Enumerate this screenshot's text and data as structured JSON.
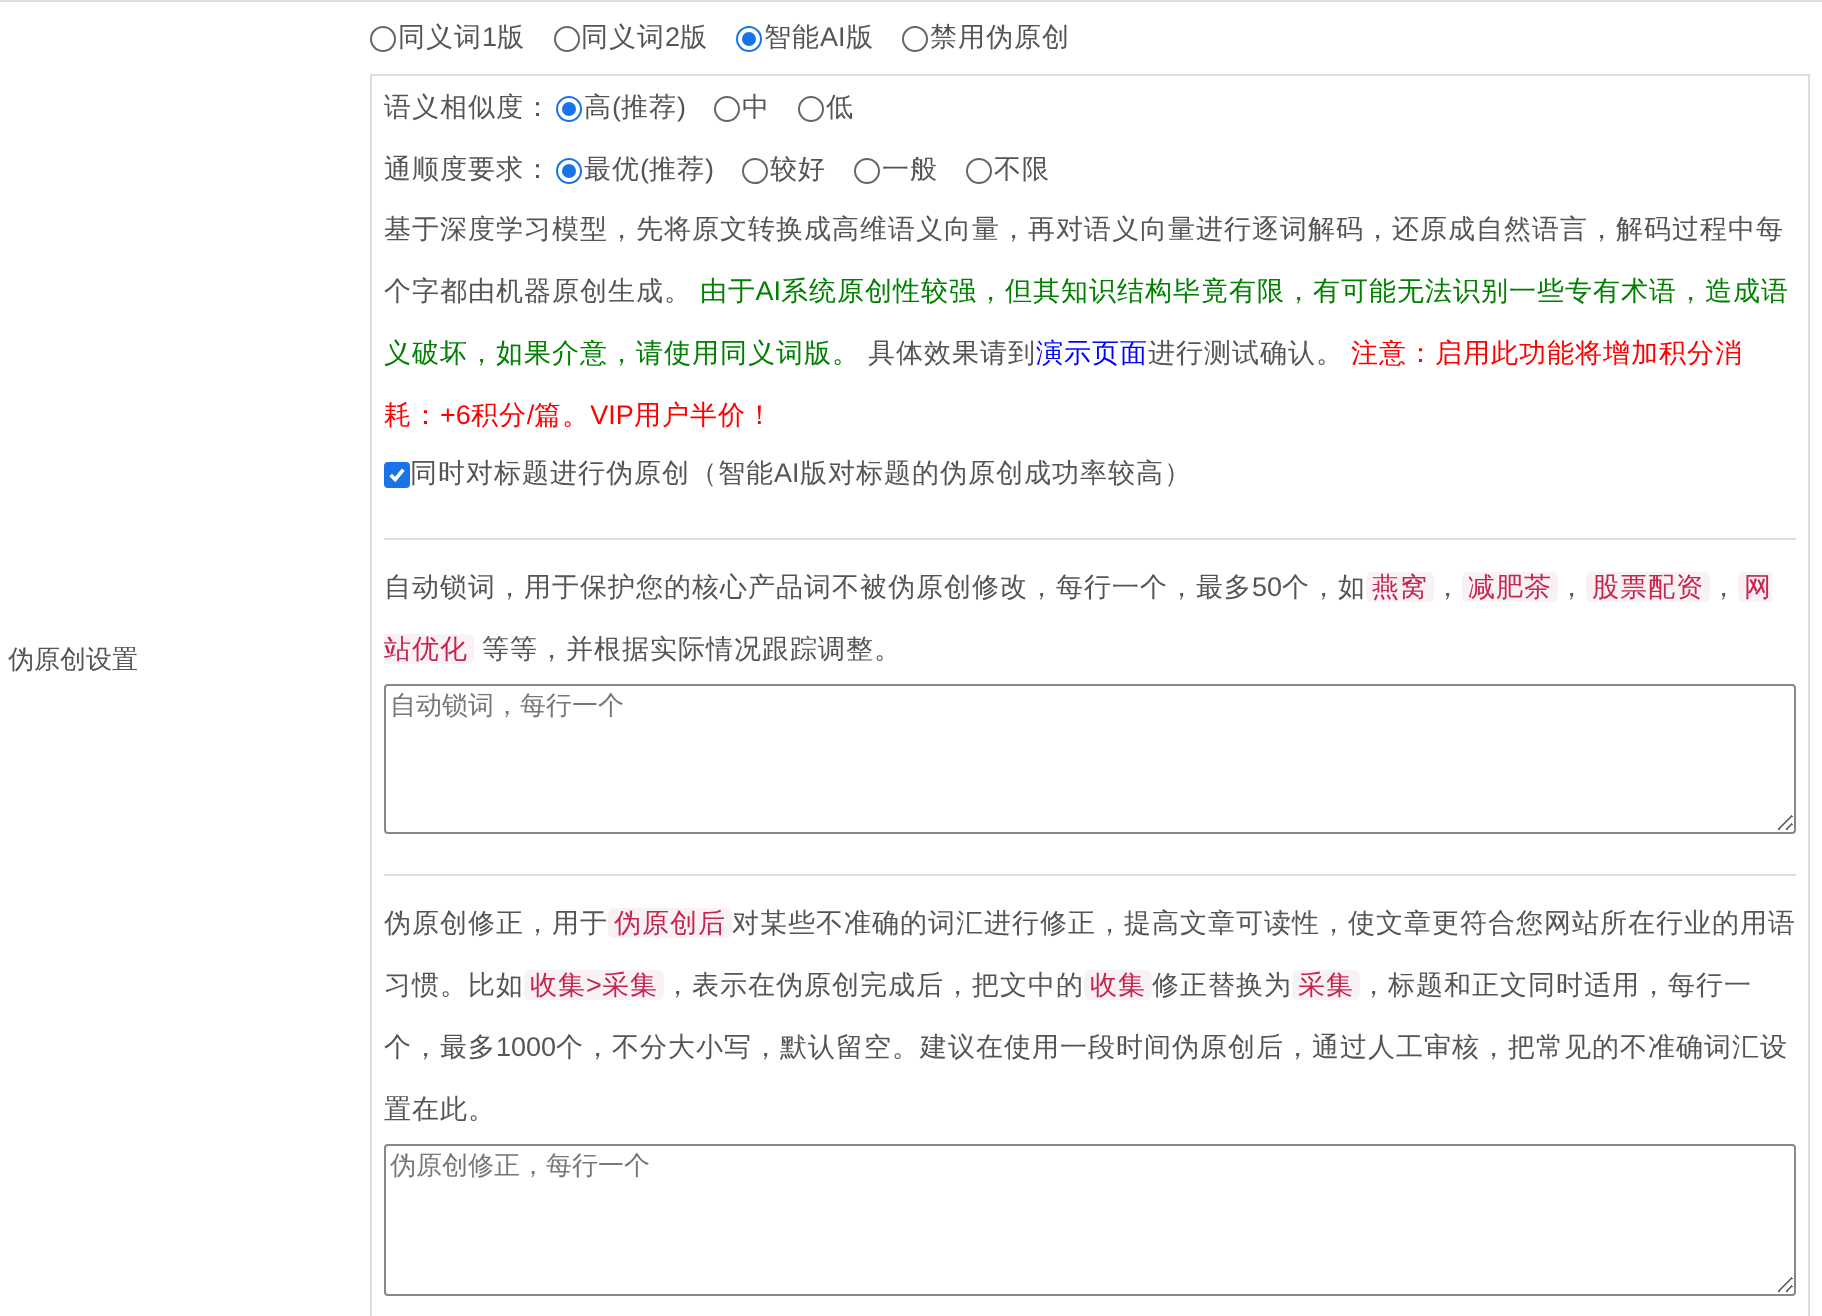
{
  "side_label": "伪原创设置",
  "modes": [
    {
      "label": "同义词1版",
      "selected": false
    },
    {
      "label": "同义词2版",
      "selected": false
    },
    {
      "label": "智能AI版",
      "selected": true
    },
    {
      "label": "禁用伪原创",
      "selected": false
    }
  ],
  "similarity": {
    "label": "语义相似度：",
    "options": [
      {
        "label": "高(推荐)",
        "selected": true
      },
      {
        "label": "中",
        "selected": false
      },
      {
        "label": "低",
        "selected": false
      }
    ]
  },
  "fluency": {
    "label": "通顺度要求：",
    "options": [
      {
        "label": "最优(推荐)",
        "selected": true
      },
      {
        "label": "较好",
        "selected": false
      },
      {
        "label": "一般",
        "selected": false
      },
      {
        "label": "不限",
        "selected": false
      }
    ]
  },
  "ai_description": [
    {
      "kind": "plain",
      "text": "基于深度学习模型，先将原文转换成高维语义向量，再对语义向量进行逐词解码，还原成自然语言，解码过程中每个字都由机器原创生成。 "
    },
    {
      "kind": "green",
      "text": "由于AI系统原创性较强，但其知识结构毕竟有限，有可能无法识别一些专有术语，造成语义破坏，如果介意，请使用同义词版。"
    },
    {
      "kind": "plain",
      "text": " 具体效果请到"
    },
    {
      "kind": "link",
      "text": "演示页面"
    },
    {
      "kind": "plain",
      "text": "进行测试确认。 "
    },
    {
      "kind": "red",
      "text": "注意：启用此功能将增加积分消耗：+6积分/篇。VIP用户半价！"
    }
  ],
  "title_option": {
    "label": "同时对标题进行伪原创（智能AI版对标题的伪原创成功率较高）",
    "checked": true
  },
  "auto_lock": {
    "description": [
      {
        "kind": "plain",
        "text": "自动锁词，用于保护您的核心产品词不被伪原创修改，每行一个，最多50个，如"
      },
      {
        "kind": "tag",
        "text": "燕窝"
      },
      {
        "kind": "plain",
        "text": "，"
      },
      {
        "kind": "tag",
        "text": "减肥茶"
      },
      {
        "kind": "plain",
        "text": "，"
      },
      {
        "kind": "tag",
        "text": "股票配资"
      },
      {
        "kind": "plain",
        "text": "，"
      },
      {
        "kind": "tag",
        "text": "网站优化"
      },
      {
        "kind": "plain",
        "text": " 等等，并根据实际情况跟踪调整。"
      }
    ],
    "placeholder": "自动锁词，每行一个"
  },
  "correction": {
    "description": [
      {
        "kind": "plain",
        "text": "伪原创修正，用于"
      },
      {
        "kind": "tag",
        "text": "伪原创后"
      },
      {
        "kind": "plain",
        "text": "对某些不准确的词汇进行修正，提高文章可读性，使文章更符合您网站所在行业的用语习惯。比如"
      },
      {
        "kind": "tag",
        "text": "收集>采集"
      },
      {
        "kind": "plain",
        "text": "，表示在伪原创完成后，把文中的"
      },
      {
        "kind": "tag",
        "text": "收集"
      },
      {
        "kind": "plain",
        "text": "修正替换为"
      },
      {
        "kind": "tag",
        "text": "采集"
      },
      {
        "kind": "plain",
        "text": "，标题和正文同时适用，每行一个，最多1000个，不分大小写，默认留空。建议在使用一段时间伪原创后，通过人工审核，把常见的不准确词汇设置在此。"
      }
    ],
    "placeholder": "伪原创修正，每行一个"
  }
}
